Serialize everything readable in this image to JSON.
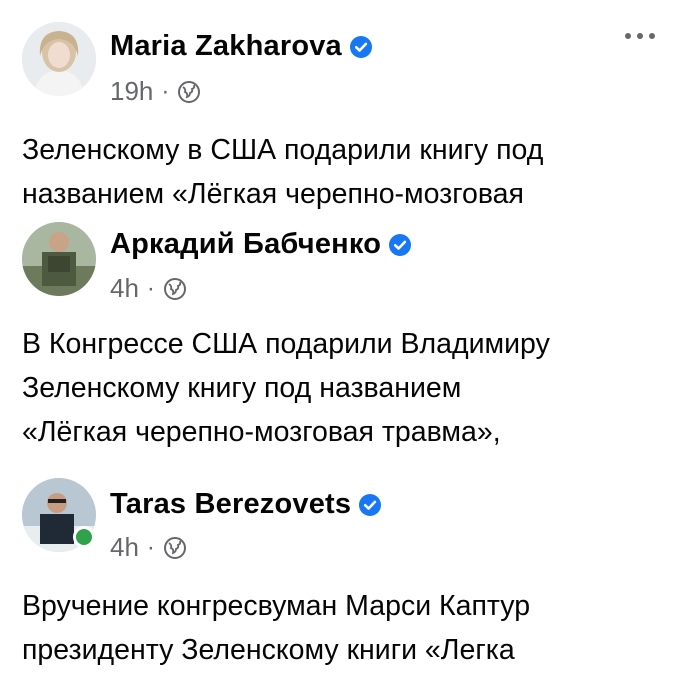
{
  "feed": {
    "posts": [
      {
        "author": "Maria Zakharova",
        "verified": true,
        "time": "19h",
        "separator": "·",
        "audience_icon": "globe-icon",
        "has_more_menu": true,
        "lines": [
          "Зеленскому в США подарили книгу  под",
          "названием «Лёгкая черепно-мозговая"
        ]
      },
      {
        "author": "Аркадий Бабченко",
        "verified": true,
        "time": "4h",
        "separator": "·",
        "audience_icon": "globe-icon",
        "lines": [
          "В Конгрессе США подарили Владимиру",
          "Зеленскому книгу  под названием",
          "«Лёгкая черепно-мозговая травма»,"
        ]
      },
      {
        "author": "Taras Berezovets",
        "verified": true,
        "online": true,
        "time": "4h",
        "separator": "·",
        "audience_icon": "globe-icon",
        "lines": [
          "Вручение конгресвуман Марси Каптур",
          "президенту Зеленскому книги «Легка"
        ]
      }
    ]
  },
  "colors": {
    "verified_blue": "#1877f2",
    "meta_gray": "#65676b",
    "online_green": "#31a24c",
    "text": "#050505"
  }
}
